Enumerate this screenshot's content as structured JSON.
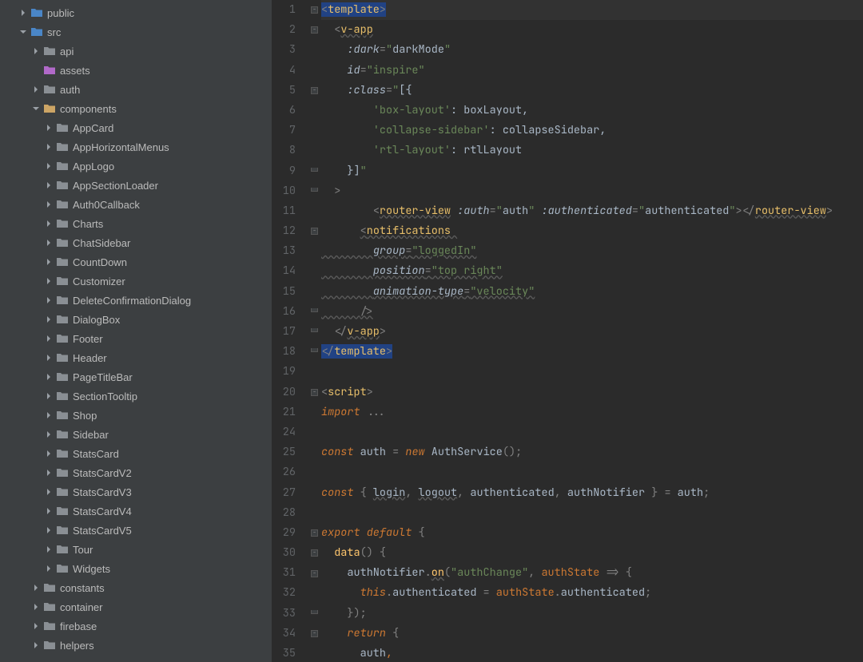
{
  "sidebar": {
    "items": [
      {
        "indent": 24,
        "arrow": "right",
        "icon": "folder-blue",
        "label": "public"
      },
      {
        "indent": 24,
        "arrow": "down",
        "icon": "folder-blue",
        "label": "src"
      },
      {
        "indent": 40,
        "arrow": "right",
        "icon": "folder",
        "label": "api"
      },
      {
        "indent": 40,
        "arrow": "",
        "icon": "folder-purple",
        "label": "assets"
      },
      {
        "indent": 40,
        "arrow": "right",
        "icon": "folder",
        "label": "auth"
      },
      {
        "indent": 40,
        "arrow": "down",
        "icon": "folder-open",
        "label": "components"
      },
      {
        "indent": 56,
        "arrow": "right",
        "icon": "folder",
        "label": "AppCard"
      },
      {
        "indent": 56,
        "arrow": "right",
        "icon": "folder",
        "label": "AppHorizontalMenus"
      },
      {
        "indent": 56,
        "arrow": "right",
        "icon": "folder",
        "label": "AppLogo"
      },
      {
        "indent": 56,
        "arrow": "right",
        "icon": "folder",
        "label": "AppSectionLoader"
      },
      {
        "indent": 56,
        "arrow": "right",
        "icon": "folder",
        "label": "Auth0Callback"
      },
      {
        "indent": 56,
        "arrow": "right",
        "icon": "folder",
        "label": "Charts"
      },
      {
        "indent": 56,
        "arrow": "right",
        "icon": "folder",
        "label": "ChatSidebar"
      },
      {
        "indent": 56,
        "arrow": "right",
        "icon": "folder",
        "label": "CountDown"
      },
      {
        "indent": 56,
        "arrow": "right",
        "icon": "folder",
        "label": "Customizer"
      },
      {
        "indent": 56,
        "arrow": "right",
        "icon": "folder",
        "label": "DeleteConfirmationDialog"
      },
      {
        "indent": 56,
        "arrow": "right",
        "icon": "folder",
        "label": "DialogBox"
      },
      {
        "indent": 56,
        "arrow": "right",
        "icon": "folder",
        "label": "Footer"
      },
      {
        "indent": 56,
        "arrow": "right",
        "icon": "folder",
        "label": "Header"
      },
      {
        "indent": 56,
        "arrow": "right",
        "icon": "folder",
        "label": "PageTitleBar"
      },
      {
        "indent": 56,
        "arrow": "right",
        "icon": "folder",
        "label": "SectionTooltip"
      },
      {
        "indent": 56,
        "arrow": "right",
        "icon": "folder",
        "label": "Shop"
      },
      {
        "indent": 56,
        "arrow": "right",
        "icon": "folder",
        "label": "Sidebar"
      },
      {
        "indent": 56,
        "arrow": "right",
        "icon": "folder",
        "label": "StatsCard"
      },
      {
        "indent": 56,
        "arrow": "right",
        "icon": "folder",
        "label": "StatsCardV2"
      },
      {
        "indent": 56,
        "arrow": "right",
        "icon": "folder",
        "label": "StatsCardV3"
      },
      {
        "indent": 56,
        "arrow": "right",
        "icon": "folder",
        "label": "StatsCardV4"
      },
      {
        "indent": 56,
        "arrow": "right",
        "icon": "folder",
        "label": "StatsCardV5"
      },
      {
        "indent": 56,
        "arrow": "right",
        "icon": "folder",
        "label": "Tour"
      },
      {
        "indent": 56,
        "arrow": "right",
        "icon": "folder",
        "label": "Widgets"
      },
      {
        "indent": 40,
        "arrow": "right",
        "icon": "folder",
        "label": "constants"
      },
      {
        "indent": 40,
        "arrow": "right",
        "icon": "folder",
        "label": "container"
      },
      {
        "indent": 40,
        "arrow": "right",
        "icon": "folder",
        "label": "firebase"
      },
      {
        "indent": 40,
        "arrow": "right",
        "icon": "folder",
        "label": "helpers"
      }
    ]
  },
  "editor": {
    "lines": [
      {
        "n": 1,
        "fold": "-",
        "hl": true,
        "html": "<span class='sel'><span class='c-gray'>&lt;</span><span class='c-tag'>template</span><span class='c-gray'>&gt;</span></span>"
      },
      {
        "n": 2,
        "fold": "-",
        "html": "  <span class='c-gray'>&lt;</span><span class='c-link'>v-app</span>"
      },
      {
        "n": 3,
        "fold": "",
        "html": "    <span class='c-attr'>:dark</span><span class='c-gray'>=</span><span class='c-str'>\"</span><span class='c-attr-v'>darkMode</span><span class='c-str'>\"</span>"
      },
      {
        "n": 4,
        "fold": "",
        "html": "    <span class='c-attr'>id</span><span class='c-gray'>=</span><span class='c-str'>\"inspire\"</span>"
      },
      {
        "n": 5,
        "fold": "-",
        "html": "    <span class='c-attr'>:class</span><span class='c-gray'>=</span><span class='c-str'>\"</span><span class='c-attr-v'>[{</span>"
      },
      {
        "n": 6,
        "fold": "",
        "html": "        <span class='c-str'>'box-layout'</span><span class='c-attr-v'>: boxLayout,</span>"
      },
      {
        "n": 7,
        "fold": "",
        "html": "        <span class='c-str'>'collapse-sidebar'</span><span class='c-attr-v'>: collapseSidebar,</span>"
      },
      {
        "n": 8,
        "fold": "",
        "html": "        <span class='c-str'>'rtl-layout'</span><span class='c-attr-v'>: rtlLayout</span>"
      },
      {
        "n": 9,
        "fold": "u",
        "html": "    <span class='c-attr-v'>}]</span><span class='c-str'>\"</span>"
      },
      {
        "n": 10,
        "fold": "u",
        "html": "  <span class='c-gray'>&gt;</span>"
      },
      {
        "n": 11,
        "fold": "",
        "html": "        <span class='c-gray'>&lt;</span><span class='c-link'>router-view</span> <span class='c-attr'>:auth</span><span class='c-gray'>=</span><span class='c-str'>\"</span><span class='c-attr-v'>auth</span><span class='c-str'>\"</span> <span class='c-attr'>:authenticated</span><span class='c-gray'>=</span><span class='c-str'>\"</span><span class='c-attr-v'>authenticated</span><span class='c-str'>\"</span><span class='c-gray'>&gt;&lt;/</span><span class='c-link'>router-view</span><span class='c-gray'>&gt;</span>"
      },
      {
        "n": 12,
        "fold": "-",
        "html": "      <span class='c-gray wavy'>&lt;</span><span class='c-link'>notifications </span>"
      },
      {
        "n": 13,
        "fold": "",
        "html": "<span class='wavy'>        </span><span class='c-attr wavy'>group</span><span class='c-gray wavy'>=</span><span class='c-link-g'>\"loggedIn\"</span>"
      },
      {
        "n": 14,
        "fold": "",
        "html": "<span class='wavy'>        </span><span class='c-attr wavy'>position</span><span class='c-gray wavy'>=</span><span class='c-link-g'>\"top right\"</span>"
      },
      {
        "n": 15,
        "fold": "",
        "html": "<span class='wavy'>        </span><span class='c-attr wavy'>animation-type</span><span class='c-gray wavy'>=</span><span class='c-link-g'>\"velocity\"</span>"
      },
      {
        "n": 16,
        "fold": "u",
        "html": "<span class='wavy'>      </span><span class='c-gray wavy'>/&gt;</span>"
      },
      {
        "n": 17,
        "fold": "u",
        "html": "  <span class='c-gray'>&lt;/</span><span class='c-link'>v-app</span><span class='c-gray'>&gt;</span>"
      },
      {
        "n": 18,
        "fold": "u",
        "html": "<span class='sel'><span class='c-gray'>&lt;/</span><span class='c-tag'>template</span><span class='c-gray'>&gt;</span></span>"
      },
      {
        "n": 19,
        "fold": "",
        "html": ""
      },
      {
        "n": 20,
        "fold": "-",
        "html": "<span class='c-gray'>&lt;</span><span class='c-tag'>script</span><span class='c-gray'>&gt;</span>"
      },
      {
        "n": 21,
        "fold": "",
        "html": "<span class='c-kw-i'>import </span><span class='c-gray'>...</span>"
      },
      {
        "n": 24,
        "fold": "",
        "html": ""
      },
      {
        "n": 25,
        "fold": "",
        "html": "<span class='c-kw-i'>const</span> <span class='c-id'>auth</span> <span class='c-gray'>=</span> <span class='c-kw-i'>new</span> <span class='c-id'>AuthService</span><span class='c-gray'>();</span>"
      },
      {
        "n": 26,
        "fold": "",
        "html": ""
      },
      {
        "n": 27,
        "fold": "",
        "html": "<span class='c-kw-i'>const</span> <span class='c-gray'>{</span> <span class='c-link-id'>login</span><span class='c-gray'>,</span> <span class='c-link-id'>logout</span><span class='c-gray'>,</span> <span class='c-id'>authenticated</span><span class='c-gray'>,</span> <span class='c-id'>authNotifier</span> <span class='c-gray'>}</span> <span class='c-gray'>=</span> <span class='c-id'>auth</span><span class='c-gray'>;</span>"
      },
      {
        "n": 28,
        "fold": "",
        "html": ""
      },
      {
        "n": 29,
        "fold": "-",
        "html": "<span class='c-kw-i'>export default</span> <span class='c-gray'>{</span>"
      },
      {
        "n": 30,
        "fold": "-",
        "html": "  <span class='c-fn'>data</span><span class='c-gray'>()</span> <span class='c-gray'>{</span>"
      },
      {
        "n": 31,
        "fold": "-",
        "html": "    <span class='c-id'>authNotifier</span><span class='c-gray'>.</span><span class='c-link-f'>on</span><span class='c-gray'>(</span><span class='c-str'>\"authChange\"</span><span class='c-gray'>,</span> <span class='c-kw'>authState</span> <span class='c-gray'>=&gt;</span> <span class='c-gray'>{</span>"
      },
      {
        "n": 32,
        "fold": "",
        "html": "      <span class='c-this'>this</span><span class='c-gray'>.</span><span class='c-id'>authenticated</span> <span class='c-gray'>=</span> <span class='c-kw'>authState</span><span class='c-gray'>.</span><span class='c-id'>authenticated</span><span class='c-gray'>;</span>"
      },
      {
        "n": 33,
        "fold": "u",
        "html": "    <span class='c-gray'>});</span>"
      },
      {
        "n": 34,
        "fold": "-",
        "html": "    <span class='c-kw-i'>return</span> <span class='c-gray'>{</span>"
      },
      {
        "n": 35,
        "fold": "",
        "html": "      <span class='c-id'>auth</span><span class='c-kw'>,</span>"
      }
    ]
  }
}
